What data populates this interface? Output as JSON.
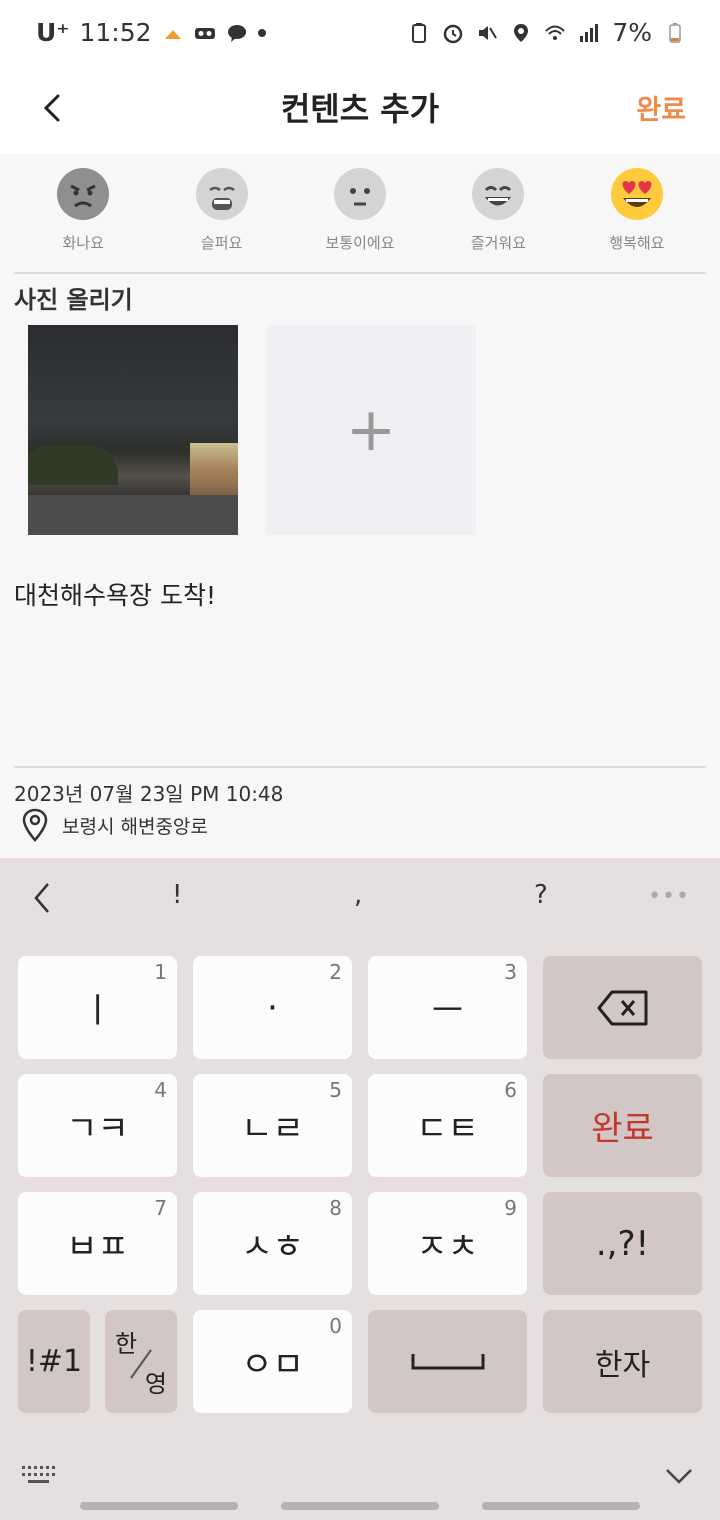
{
  "status": {
    "carrier": "U⁺",
    "time": "11:52",
    "battery": "7%"
  },
  "header": {
    "title": "컨텐츠 추가",
    "done_label": "완료"
  },
  "emotions": [
    {
      "label": "화나요",
      "icon": "angry-face-icon"
    },
    {
      "label": "슬퍼요",
      "icon": "sad-face-icon"
    },
    {
      "label": "보통이에요",
      "icon": "neutral-face-icon"
    },
    {
      "label": "즐거워요",
      "icon": "grinning-face-icon"
    },
    {
      "label": "행복해요",
      "icon": "heart-eyes-face-icon"
    }
  ],
  "photos": {
    "section_title": "사진 올리기",
    "add_label": "+"
  },
  "content": {
    "text": "대천해수욕장 도착!"
  },
  "meta": {
    "datetime": "2023년 07월 23일 PM 10:48",
    "location": "보령시 해변중앙로"
  },
  "keyboard": {
    "suggestions": [
      "!",
      ",",
      "?"
    ],
    "more": "•••",
    "rows": [
      [
        {
          "label": "ㅣ",
          "num": "1"
        },
        {
          "label": "·",
          "num": "2"
        },
        {
          "label": "ㅡ",
          "num": "3"
        }
      ],
      [
        {
          "label": "ㄱㅋ",
          "num": "4"
        },
        {
          "label": "ㄴㄹ",
          "num": "5"
        },
        {
          "label": "ㄷㅌ",
          "num": "6"
        }
      ],
      [
        {
          "label": "ㅂㅍ",
          "num": "7"
        },
        {
          "label": "ㅅㅎ",
          "num": "8"
        },
        {
          "label": "ㅈㅊ",
          "num": "9"
        }
      ]
    ],
    "enter_label": "완료",
    "punct_label": ".,?!",
    "symbols_label": "!#1",
    "lang_top": "한",
    "lang_bottom": "영",
    "om_label": "ㅇㅁ",
    "om_num": "0",
    "hanja_label": "한자"
  }
}
